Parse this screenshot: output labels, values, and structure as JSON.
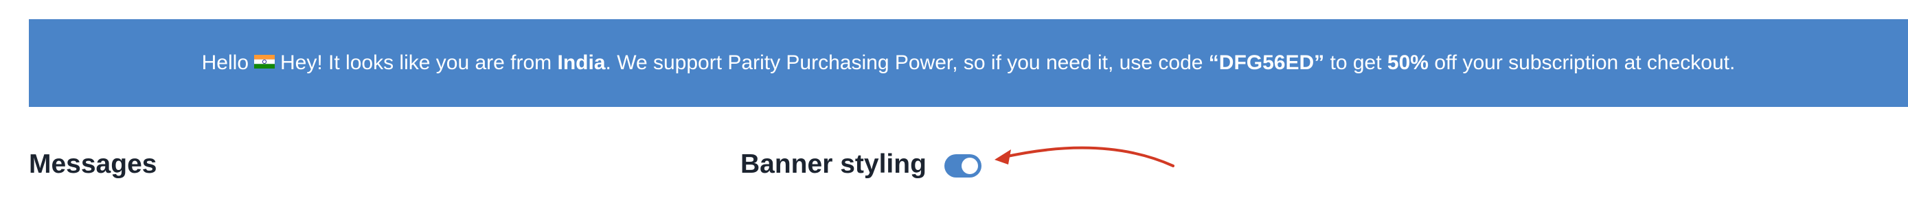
{
  "banner": {
    "greeting": "Hello",
    "flag_icon": "india-flag-icon",
    "text_1": "Hey! It looks like you are from",
    "country": "India",
    "text_2": ". We support Parity Purchasing Power, so if you need it, use code",
    "code": "“DFG56ED”",
    "text_3": "to get",
    "discount": "50%",
    "text_4": "off your subscription at checkout.",
    "background_color": "#4a84c8"
  },
  "messages": {
    "title": "Messages"
  },
  "banner_styling": {
    "label": "Banner styling",
    "toggle_on": true,
    "toggle_color": "#4a84c8"
  },
  "annotation": {
    "arrow_icon": "red-arrow-icon",
    "arrow_color": "#d23a24"
  }
}
